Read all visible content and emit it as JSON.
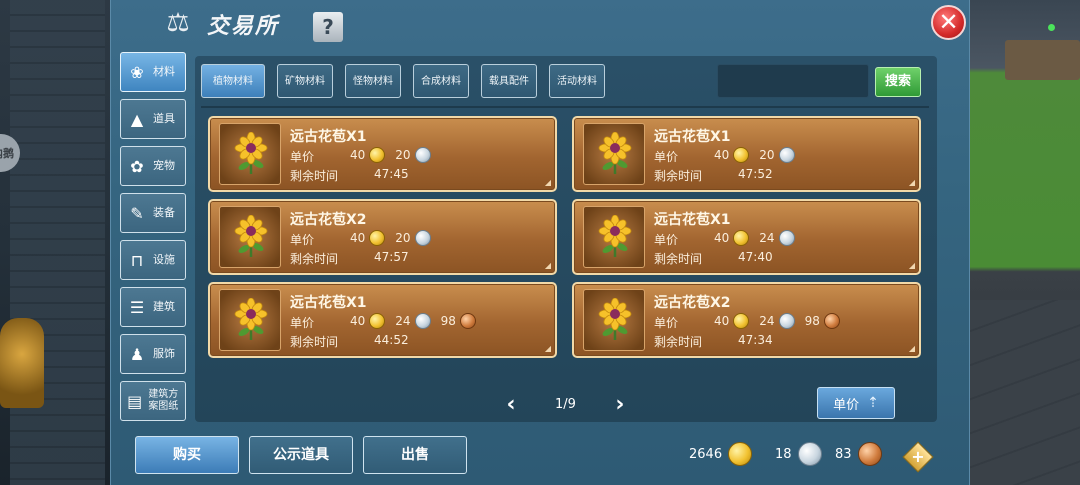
{
  "side_bubble": "内鹅",
  "window": {
    "title": "交易所",
    "title_icon": "scales-icon",
    "help_label": "?",
    "close_label": "✕"
  },
  "categories": [
    {
      "label": "材料",
      "icon": "materials-icon",
      "active": true
    },
    {
      "label": "道具",
      "icon": "item-icon",
      "active": false
    },
    {
      "label": "宠物",
      "icon": "paw-icon",
      "active": false
    },
    {
      "label": "装备",
      "icon": "equipment-icon",
      "active": false
    },
    {
      "label": "设施",
      "icon": "facility-icon",
      "active": false
    },
    {
      "label": "建筑",
      "icon": "building-icon",
      "active": false
    },
    {
      "label": "服饰",
      "icon": "clothing-icon",
      "active": false
    },
    {
      "label": "建筑方案图纸",
      "icon": "blueprint-icon",
      "active": false
    }
  ],
  "tabs": [
    {
      "label": "植物材料",
      "active": true
    },
    {
      "label": "矿物材料",
      "active": false
    },
    {
      "label": "怪物材料",
      "active": false
    },
    {
      "label": "合成材料",
      "active": false
    },
    {
      "label": "载具配件",
      "active": false
    },
    {
      "label": "活动材料",
      "active": false
    }
  ],
  "search": {
    "placeholder": "",
    "button_label": "搜索"
  },
  "price_label": "单价",
  "time_label": "剩余时间",
  "listings": [
    {
      "name": "远古花苞X1",
      "gold": "40",
      "silver": "20",
      "copper": "",
      "time": "47:45"
    },
    {
      "name": "远古花苞X1",
      "gold": "40",
      "silver": "20",
      "copper": "",
      "time": "47:52"
    },
    {
      "name": "远古花苞X2",
      "gold": "40",
      "silver": "20",
      "copper": "",
      "time": "47:57"
    },
    {
      "name": "远古花苞X1",
      "gold": "40",
      "silver": "24",
      "copper": "",
      "time": "47:40"
    },
    {
      "name": "远古花苞X1",
      "gold": "40",
      "silver": "24",
      "copper": "98",
      "time": "44:52"
    },
    {
      "name": "远古花苞X2",
      "gold": "40",
      "silver": "24",
      "copper": "98",
      "time": "47:34"
    }
  ],
  "pager": {
    "prev": "‹",
    "page": "1/9",
    "next": "›"
  },
  "sort_button": {
    "label": "单价"
  },
  "actions": {
    "buy": "购买",
    "publish": "公示道具",
    "sell": "出售"
  },
  "wallet": {
    "gold": "2646",
    "silver": "18",
    "copper": "83"
  },
  "colors": {
    "accent": "#3d80ba",
    "card": "#a26530",
    "search_green": "#2f9a36",
    "close_red": "#d42a2a"
  }
}
